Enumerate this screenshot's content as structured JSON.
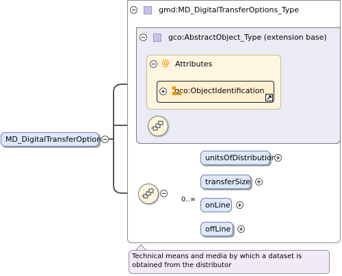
{
  "root_element": {
    "label": "MD_DigitalTransferOptions"
  },
  "complex_type": {
    "label": "gmd:MD_DigitalTransferOptions_Type"
  },
  "base_type": {
    "label": "gco:AbstractObject_Type (extension base)"
  },
  "attributes_group": {
    "label": "Attributes",
    "icon": "at-icon"
  },
  "attribute_group_ref": {
    "label": "gco:ObjectIdentification"
  },
  "sequence_children": [
    {
      "label": "unitsOfDistribution",
      "cardinality": ""
    },
    {
      "label": "transferSize",
      "cardinality": ""
    },
    {
      "label": "onLine",
      "cardinality": "0..∞"
    },
    {
      "label": "offLine",
      "cardinality": ""
    }
  ],
  "documentation": {
    "text": "Technical means and media by which a dataset is obtained from the distributor"
  },
  "colors": {
    "element_fill": "#dfe8fa",
    "element_border": "#6b7fb3",
    "type_box_fill": "#ebebf5",
    "attributes_fill": "#fff6e1",
    "compositor_fill": "#fbf5dc",
    "connector": "#555555"
  }
}
